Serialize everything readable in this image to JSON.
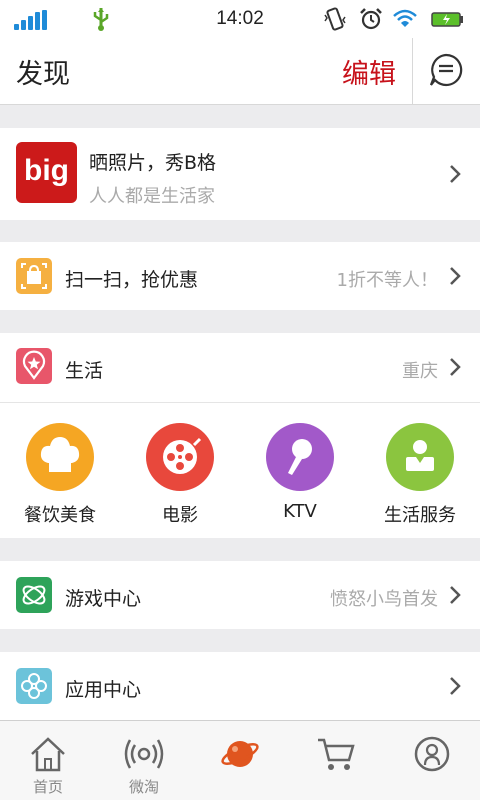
{
  "status_bar": {
    "time": "14:02"
  },
  "header": {
    "title": "发现",
    "edit_label": "编辑"
  },
  "big_card": {
    "logo_text": "big",
    "title": "晒照片，秀B格",
    "subtitle": "人人都是生活家"
  },
  "scan_row": {
    "label": "扫一扫，抢优惠",
    "right_text": "1折不等人！"
  },
  "life_row": {
    "label": "生活",
    "right_text": "重庆"
  },
  "life_grid": [
    {
      "label": "餐饮美食",
      "icon": "chef-hat-icon",
      "color": "#f5a623"
    },
    {
      "label": "电影",
      "icon": "film-reel-icon",
      "color": "#e8483c"
    },
    {
      "label": "KTV",
      "icon": "microphone-icon",
      "color": "#a259c9"
    },
    {
      "label": "生活服务",
      "icon": "service-person-icon",
      "color": "#8bc53f"
    }
  ],
  "game_row": {
    "label": "游戏中心",
    "right_text": "愤怒小鸟首发"
  },
  "app_row": {
    "label": "应用中心",
    "right_text": ""
  },
  "tabbar": {
    "items": [
      {
        "label": "首页",
        "icon": "home-icon",
        "active": false
      },
      {
        "label": "微淘",
        "icon": "broadcast-icon",
        "active": false
      },
      {
        "label": "",
        "icon": "planet-icon",
        "active": true
      },
      {
        "label": "",
        "icon": "cart-icon",
        "active": false
      },
      {
        "label": "",
        "icon": "profile-icon",
        "active": false
      }
    ]
  },
  "colors": {
    "accent_red": "#c7121b",
    "tab_active": "#e0551f",
    "signal_blue": "#1f8bd8"
  }
}
